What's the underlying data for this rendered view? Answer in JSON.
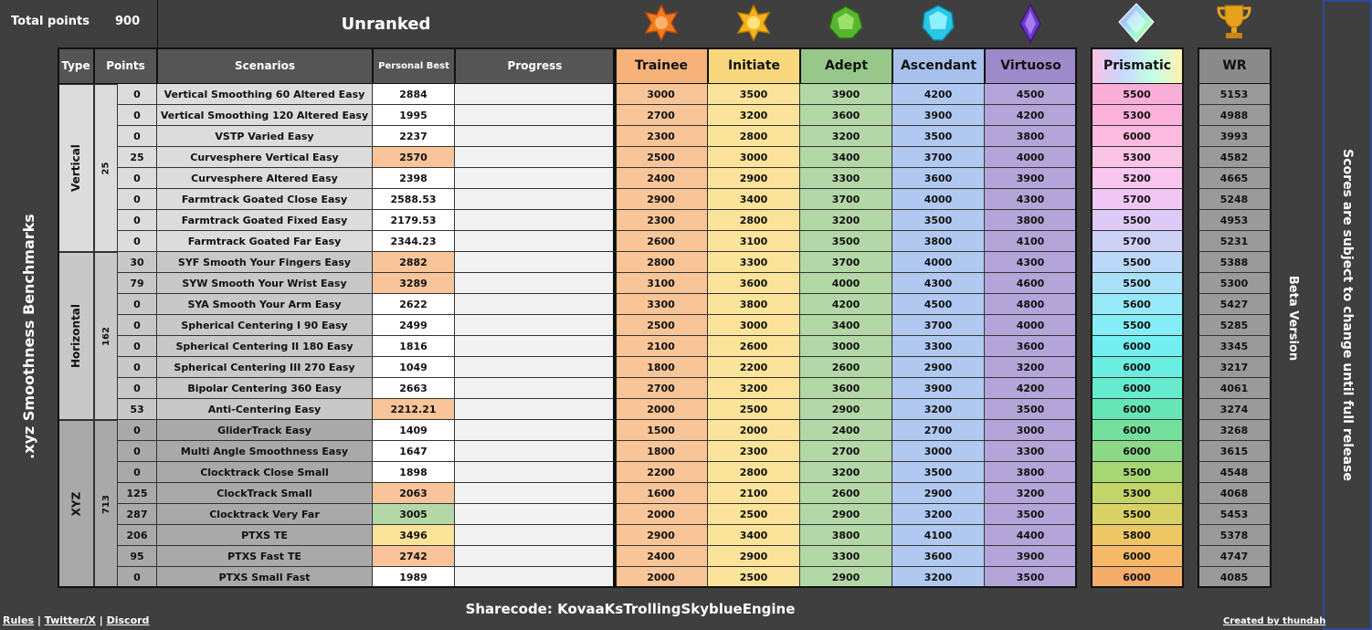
{
  "header": {
    "total_points_label": "Total points",
    "total_points_value": "900",
    "rank_status": "Unranked"
  },
  "columns": {
    "type": "Type",
    "points": "Points",
    "scenarios": "Scenarios",
    "personal_best": "Personal Best",
    "progress": "Progress",
    "wr": "WR"
  },
  "ranks": [
    {
      "name": "Trainee",
      "color": "#f7b27a",
      "cell_color": "#f8c598",
      "gem_color": "#f07b1e"
    },
    {
      "name": "Initiate",
      "color": "#f9d77c",
      "cell_color": "#fbe39a",
      "gem_color": "#f5b31b"
    },
    {
      "name": "Adept",
      "color": "#97c889",
      "cell_color": "#b3d7a6",
      "gem_color": "#57b52e"
    },
    {
      "name": "Ascendant",
      "color": "#a8c1ec",
      "cell_color": "#b1c9f1",
      "gem_color": "#29c6e8"
    },
    {
      "name": "Virtuoso",
      "color": "#9c8acb",
      "cell_color": "#b3a5d8",
      "gem_color": "#6a39c7"
    }
  ],
  "prismatic": {
    "name": "Prismatic"
  },
  "title_vertical": ".xyz Smoothness Benchmarks",
  "beta": "Beta Version",
  "disclaimer": "Scores are subject to change until full release",
  "sharecode": "Sharecode: KovaaKsTrollingSkyblueEngine",
  "links": {
    "rules": "Rules",
    "sep1": " | ",
    "twitter": "Twitter/X",
    "sep2": " | ",
    "discord": "Discord"
  },
  "credit": "Created by thundah",
  "groups": [
    {
      "type": "Vertical",
      "points": "25",
      "color": "#dcdcdc"
    },
    {
      "type": "Horizontal",
      "points": "162",
      "color": "#c8c8c8"
    },
    {
      "type": "XYZ",
      "points": "713",
      "color": "#a9a9a9"
    }
  ],
  "rows": [
    {
      "g": 0,
      "pts": "0",
      "name": "Vertical Smoothing 60 Altered Easy",
      "pb": "2884",
      "pbc": "#ffffff",
      "r": [
        "3000",
        "3500",
        "3900",
        "4200",
        "4500"
      ],
      "p": "5500",
      "pc": "#fbaed8",
      "wr": "5153"
    },
    {
      "g": 0,
      "pts": "0",
      "name": "Vertical Smoothing 120 Altered Easy",
      "pb": "1995",
      "pbc": "#ffffff",
      "r": [
        "2700",
        "3200",
        "3600",
        "3900",
        "4200"
      ],
      "p": "5300",
      "pc": "#fcb2dc",
      "wr": "4988"
    },
    {
      "g": 0,
      "pts": "0",
      "name": "VSTP Varied Easy",
      "pb": "2237",
      "pbc": "#ffffff",
      "r": [
        "2300",
        "2800",
        "3200",
        "3500",
        "3800"
      ],
      "p": "6000",
      "pc": "#fcbadf",
      "wr": "3993"
    },
    {
      "g": 0,
      "pts": "25",
      "name": "Curvesphere Vertical Easy",
      "pb": "2570",
      "pbc": "#f9c49a",
      "r": [
        "2500",
        "3000",
        "3400",
        "3700",
        "4000"
      ],
      "p": "5300",
      "pc": "#fbc3e6",
      "wr": "4582"
    },
    {
      "g": 0,
      "pts": "0",
      "name": "Curvesphere Altered Easy",
      "pb": "2398",
      "pbc": "#ffffff",
      "r": [
        "2400",
        "2900",
        "3300",
        "3600",
        "3900"
      ],
      "p": "5200",
      "pc": "#f8c6ef",
      "wr": "4665"
    },
    {
      "g": 0,
      "pts": "0",
      "name": "Farmtrack Goated Close Easy",
      "pb": "2588.53",
      "pbc": "#ffffff",
      "r": [
        "2900",
        "3400",
        "3700",
        "4000",
        "4300"
      ],
      "p": "5700",
      "pc": "#f0c6f5",
      "wr": "5248"
    },
    {
      "g": 0,
      "pts": "0",
      "name": "Farmtrack Goated Fixed Easy",
      "pb": "2179.53",
      "pbc": "#ffffff",
      "r": [
        "2300",
        "2800",
        "3200",
        "3500",
        "3800"
      ],
      "p": "5500",
      "pc": "#dec9f7",
      "wr": "4953"
    },
    {
      "g": 0,
      "pts": "0",
      "name": "Farmtrack Goated Far Easy",
      "pb": "2344.23",
      "pbc": "#ffffff",
      "r": [
        "2600",
        "3100",
        "3500",
        "3800",
        "4100"
      ],
      "p": "5700",
      "pc": "#cdd0f7",
      "wr": "5231"
    },
    {
      "g": 1,
      "pts": "30",
      "name": "SYF Smooth Your Fingers Easy",
      "pb": "2882",
      "pbc": "#f9c49a",
      "r": [
        "2800",
        "3300",
        "3700",
        "4000",
        "4300"
      ],
      "p": "5500",
      "pc": "#bcd8f8",
      "wr": "5388"
    },
    {
      "g": 1,
      "pts": "79",
      "name": "SYW Smooth Your Wrist Easy",
      "pb": "3289",
      "pbc": "#f9c49a",
      "r": [
        "3100",
        "3600",
        "4000",
        "4300",
        "4600"
      ],
      "p": "5500",
      "pc": "#a9e1f9",
      "wr": "5300"
    },
    {
      "g": 1,
      "pts": "0",
      "name": "SYA Smooth Your Arm Easy",
      "pb": "2622",
      "pbc": "#ffffff",
      "r": [
        "3300",
        "3800",
        "4200",
        "4500",
        "4800"
      ],
      "p": "5600",
      "pc": "#97e8f8",
      "wr": "5427"
    },
    {
      "g": 1,
      "pts": "0",
      "name": "Spherical Centering I 90 Easy",
      "pb": "2499",
      "pbc": "#ffffff",
      "r": [
        "2500",
        "3000",
        "3400",
        "3700",
        "4000"
      ],
      "p": "5500",
      "pc": "#84edf6",
      "wr": "5285"
    },
    {
      "g": 1,
      "pts": "0",
      "name": "Spherical Centering II 180 Easy",
      "pb": "1816",
      "pbc": "#ffffff",
      "r": [
        "2100",
        "2600",
        "3000",
        "3300",
        "3600"
      ],
      "p": "6000",
      "pc": "#73eff2",
      "wr": "3345"
    },
    {
      "g": 1,
      "pts": "0",
      "name": "Spherical Centering III 270 Easy",
      "pb": "1049",
      "pbc": "#ffffff",
      "r": [
        "1800",
        "2200",
        "2600",
        "2900",
        "3200"
      ],
      "p": "6000",
      "pc": "#6aeee2",
      "wr": "3217"
    },
    {
      "g": 1,
      "pts": "0",
      "name": "Bipolar Centering 360 Easy",
      "pb": "2663",
      "pbc": "#ffffff",
      "r": [
        "2700",
        "3200",
        "3600",
        "3900",
        "4200"
      ],
      "p": "6000",
      "pc": "#66ebcf",
      "wr": "4061"
    },
    {
      "g": 1,
      "pts": "53",
      "name": "Anti-Centering Easy",
      "pb": "2212.21",
      "pbc": "#f9c49a",
      "r": [
        "2000",
        "2500",
        "2900",
        "3200",
        "3500"
      ],
      "p": "6000",
      "pc": "#66e6b8",
      "wr": "3274"
    },
    {
      "g": 2,
      "pts": "0",
      "name": "GliderTrack Easy",
      "pb": "1409",
      "pbc": "#ffffff",
      "r": [
        "1500",
        "2000",
        "2400",
        "2700",
        "3000"
      ],
      "p": "6000",
      "pc": "#74e09e",
      "wr": "3268"
    },
    {
      "g": 2,
      "pts": "0",
      "name": "Multi Angle Smoothness Easy",
      "pb": "1647",
      "pbc": "#ffffff",
      "r": [
        "1800",
        "2300",
        "2700",
        "3000",
        "3300"
      ],
      "p": "6000",
      "pc": "#8bd987",
      "wr": "3615"
    },
    {
      "g": 2,
      "pts": "0",
      "name": "Clocktrack Close Small",
      "pb": "1898",
      "pbc": "#ffffff",
      "r": [
        "2200",
        "2800",
        "3200",
        "3500",
        "3800"
      ],
      "p": "5500",
      "pc": "#a7d674",
      "wr": "4548"
    },
    {
      "g": 2,
      "pts": "125",
      "name": "ClockTrack Small",
      "pb": "2063",
      "pbc": "#f9c49a",
      "r": [
        "1600",
        "2100",
        "2600",
        "2900",
        "3200"
      ],
      "p": "5300",
      "pc": "#c3d569",
      "wr": "4068"
    },
    {
      "g": 2,
      "pts": "287",
      "name": "Clocktrack Very Far",
      "pb": "3005",
      "pbc": "#b3d7a6",
      "r": [
        "2000",
        "2500",
        "2900",
        "3200",
        "3500"
      ],
      "p": "5500",
      "pc": "#d9d164",
      "wr": "5453"
    },
    {
      "g": 2,
      "pts": "206",
      "name": "PTXS TE",
      "pb": "3496",
      "pbc": "#fbe39a",
      "r": [
        "2900",
        "3400",
        "3800",
        "4100",
        "4400"
      ],
      "p": "5800",
      "pc": "#ecc763",
      "wr": "5378"
    },
    {
      "g": 2,
      "pts": "95",
      "name": "PTXS Fast TE",
      "pb": "2742",
      "pbc": "#f9c49a",
      "r": [
        "2400",
        "2900",
        "3300",
        "3600",
        "3900"
      ],
      "p": "6000",
      "pc": "#f5b968",
      "wr": "4747"
    },
    {
      "g": 2,
      "pts": "0",
      "name": "PTXS Small Fast",
      "pb": "1989",
      "pbc": "#ffffff",
      "r": [
        "2000",
        "2500",
        "2900",
        "3200",
        "3500"
      ],
      "p": "6000",
      "pc": "#f7ad6a",
      "wr": "4085"
    }
  ]
}
